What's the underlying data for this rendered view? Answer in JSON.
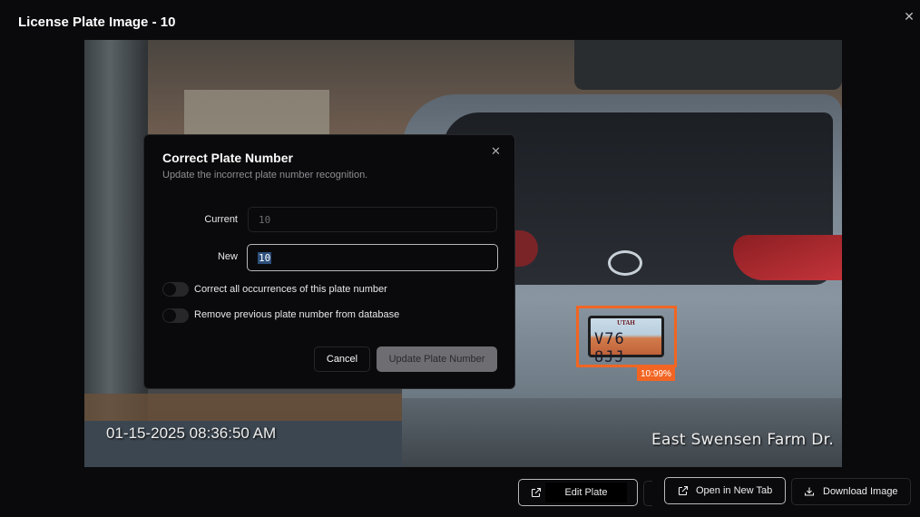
{
  "modal": {
    "title": "License Plate Image - 10",
    "close_icon": "close-icon"
  },
  "image": {
    "timestamp": "01-15-2025 08:36:50 AM",
    "location": "East Swensen Farm Dr.",
    "plate_state": "UTAH",
    "plate_text": "V76 8JJ",
    "detection_label": "10:99%",
    "detection_color": "#f26522"
  },
  "dialog": {
    "title": "Correct Plate Number",
    "description": "Update the incorrect plate number recognition.",
    "current_label": "Current",
    "current_value": "10",
    "new_label": "New",
    "new_value": "10",
    "toggle_all_label": "Correct all occurrences of this plate number",
    "toggle_all_on": false,
    "toggle_remove_label": "Remove previous plate number from database",
    "toggle_remove_on": false,
    "cancel_label": "Cancel",
    "submit_label": "Update Plate Number"
  },
  "footer": {
    "edit_plate_label": "Edit Plate",
    "open_new_tab_label": "Open in New Tab",
    "download_label": "Download Image"
  }
}
